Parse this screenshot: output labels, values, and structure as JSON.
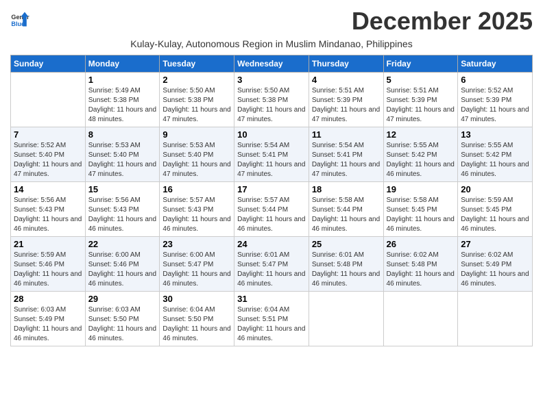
{
  "logo": {
    "line1": "General",
    "line2": "Blue"
  },
  "title": "December 2025",
  "subtitle": "Kulay-Kulay, Autonomous Region in Muslim Mindanao, Philippines",
  "days_of_week": [
    "Sunday",
    "Monday",
    "Tuesday",
    "Wednesday",
    "Thursday",
    "Friday",
    "Saturday"
  ],
  "weeks": [
    [
      {
        "day": "",
        "sunrise": "",
        "sunset": "",
        "daylight": "",
        "empty": true
      },
      {
        "day": "1",
        "sunrise": "Sunrise: 5:49 AM",
        "sunset": "Sunset: 5:38 PM",
        "daylight": "Daylight: 11 hours and 48 minutes."
      },
      {
        "day": "2",
        "sunrise": "Sunrise: 5:50 AM",
        "sunset": "Sunset: 5:38 PM",
        "daylight": "Daylight: 11 hours and 47 minutes."
      },
      {
        "day": "3",
        "sunrise": "Sunrise: 5:50 AM",
        "sunset": "Sunset: 5:38 PM",
        "daylight": "Daylight: 11 hours and 47 minutes."
      },
      {
        "day": "4",
        "sunrise": "Sunrise: 5:51 AM",
        "sunset": "Sunset: 5:39 PM",
        "daylight": "Daylight: 11 hours and 47 minutes."
      },
      {
        "day": "5",
        "sunrise": "Sunrise: 5:51 AM",
        "sunset": "Sunset: 5:39 PM",
        "daylight": "Daylight: 11 hours and 47 minutes."
      },
      {
        "day": "6",
        "sunrise": "Sunrise: 5:52 AM",
        "sunset": "Sunset: 5:39 PM",
        "daylight": "Daylight: 11 hours and 47 minutes."
      }
    ],
    [
      {
        "day": "7",
        "sunrise": "Sunrise: 5:52 AM",
        "sunset": "Sunset: 5:40 PM",
        "daylight": "Daylight: 11 hours and 47 minutes."
      },
      {
        "day": "8",
        "sunrise": "Sunrise: 5:53 AM",
        "sunset": "Sunset: 5:40 PM",
        "daylight": "Daylight: 11 hours and 47 minutes."
      },
      {
        "day": "9",
        "sunrise": "Sunrise: 5:53 AM",
        "sunset": "Sunset: 5:40 PM",
        "daylight": "Daylight: 11 hours and 47 minutes."
      },
      {
        "day": "10",
        "sunrise": "Sunrise: 5:54 AM",
        "sunset": "Sunset: 5:41 PM",
        "daylight": "Daylight: 11 hours and 47 minutes."
      },
      {
        "day": "11",
        "sunrise": "Sunrise: 5:54 AM",
        "sunset": "Sunset: 5:41 PM",
        "daylight": "Daylight: 11 hours and 47 minutes."
      },
      {
        "day": "12",
        "sunrise": "Sunrise: 5:55 AM",
        "sunset": "Sunset: 5:42 PM",
        "daylight": "Daylight: 11 hours and 46 minutes."
      },
      {
        "day": "13",
        "sunrise": "Sunrise: 5:55 AM",
        "sunset": "Sunset: 5:42 PM",
        "daylight": "Daylight: 11 hours and 46 minutes."
      }
    ],
    [
      {
        "day": "14",
        "sunrise": "Sunrise: 5:56 AM",
        "sunset": "Sunset: 5:43 PM",
        "daylight": "Daylight: 11 hours and 46 minutes."
      },
      {
        "day": "15",
        "sunrise": "Sunrise: 5:56 AM",
        "sunset": "Sunset: 5:43 PM",
        "daylight": "Daylight: 11 hours and 46 minutes."
      },
      {
        "day": "16",
        "sunrise": "Sunrise: 5:57 AM",
        "sunset": "Sunset: 5:43 PM",
        "daylight": "Daylight: 11 hours and 46 minutes."
      },
      {
        "day": "17",
        "sunrise": "Sunrise: 5:57 AM",
        "sunset": "Sunset: 5:44 PM",
        "daylight": "Daylight: 11 hours and 46 minutes."
      },
      {
        "day": "18",
        "sunrise": "Sunrise: 5:58 AM",
        "sunset": "Sunset: 5:44 PM",
        "daylight": "Daylight: 11 hours and 46 minutes."
      },
      {
        "day": "19",
        "sunrise": "Sunrise: 5:58 AM",
        "sunset": "Sunset: 5:45 PM",
        "daylight": "Daylight: 11 hours and 46 minutes."
      },
      {
        "day": "20",
        "sunrise": "Sunrise: 5:59 AM",
        "sunset": "Sunset: 5:45 PM",
        "daylight": "Daylight: 11 hours and 46 minutes."
      }
    ],
    [
      {
        "day": "21",
        "sunrise": "Sunrise: 5:59 AM",
        "sunset": "Sunset: 5:46 PM",
        "daylight": "Daylight: 11 hours and 46 minutes."
      },
      {
        "day": "22",
        "sunrise": "Sunrise: 6:00 AM",
        "sunset": "Sunset: 5:46 PM",
        "daylight": "Daylight: 11 hours and 46 minutes."
      },
      {
        "day": "23",
        "sunrise": "Sunrise: 6:00 AM",
        "sunset": "Sunset: 5:47 PM",
        "daylight": "Daylight: 11 hours and 46 minutes."
      },
      {
        "day": "24",
        "sunrise": "Sunrise: 6:01 AM",
        "sunset": "Sunset: 5:47 PM",
        "daylight": "Daylight: 11 hours and 46 minutes."
      },
      {
        "day": "25",
        "sunrise": "Sunrise: 6:01 AM",
        "sunset": "Sunset: 5:48 PM",
        "daylight": "Daylight: 11 hours and 46 minutes."
      },
      {
        "day": "26",
        "sunrise": "Sunrise: 6:02 AM",
        "sunset": "Sunset: 5:48 PM",
        "daylight": "Daylight: 11 hours and 46 minutes."
      },
      {
        "day": "27",
        "sunrise": "Sunrise: 6:02 AM",
        "sunset": "Sunset: 5:49 PM",
        "daylight": "Daylight: 11 hours and 46 minutes."
      }
    ],
    [
      {
        "day": "28",
        "sunrise": "Sunrise: 6:03 AM",
        "sunset": "Sunset: 5:49 PM",
        "daylight": "Daylight: 11 hours and 46 minutes."
      },
      {
        "day": "29",
        "sunrise": "Sunrise: 6:03 AM",
        "sunset": "Sunset: 5:50 PM",
        "daylight": "Daylight: 11 hours and 46 minutes."
      },
      {
        "day": "30",
        "sunrise": "Sunrise: 6:04 AM",
        "sunset": "Sunset: 5:50 PM",
        "daylight": "Daylight: 11 hours and 46 minutes."
      },
      {
        "day": "31",
        "sunrise": "Sunrise: 6:04 AM",
        "sunset": "Sunset: 5:51 PM",
        "daylight": "Daylight: 11 hours and 46 minutes."
      },
      {
        "day": "",
        "sunrise": "",
        "sunset": "",
        "daylight": "",
        "empty": true
      },
      {
        "day": "",
        "sunrise": "",
        "sunset": "",
        "daylight": "",
        "empty": true
      },
      {
        "day": "",
        "sunrise": "",
        "sunset": "",
        "daylight": "",
        "empty": true
      }
    ]
  ]
}
